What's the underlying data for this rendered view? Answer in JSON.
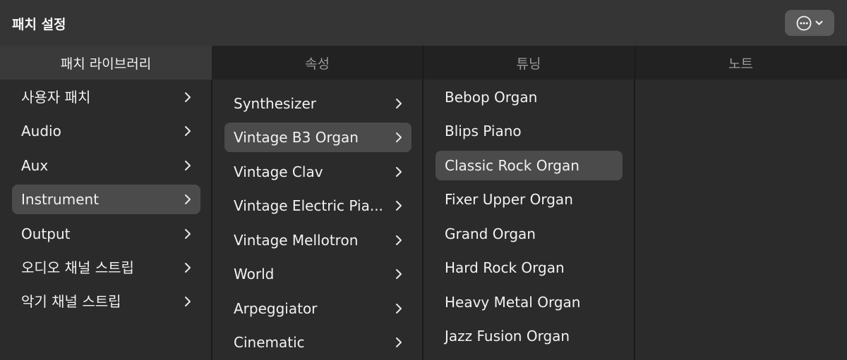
{
  "header": {
    "title": "패치 설정",
    "more_icon": "ellipsis-circle-icon",
    "menu_icon": "chevron-down-icon"
  },
  "tabs": [
    {
      "label": "패치 라이브러리",
      "active": true
    },
    {
      "label": "속성",
      "active": false
    },
    {
      "label": "튜닝",
      "active": false
    },
    {
      "label": "노트",
      "active": false
    }
  ],
  "library": {
    "items": [
      {
        "label": "사용자 패치"
      },
      {
        "label": "Audio"
      },
      {
        "label": "Aux"
      },
      {
        "label": "Instrument",
        "selected": true
      },
      {
        "label": "Output"
      },
      {
        "label": "오디오 채널 스트립"
      },
      {
        "label": "악기 채널 스트립"
      }
    ]
  },
  "categories": {
    "items": [
      {
        "label": "Synthesizer"
      },
      {
        "label": "Vintage B3 Organ",
        "selected": true
      },
      {
        "label": "Vintage Clav"
      },
      {
        "label": "Vintage Electric Pia..."
      },
      {
        "label": "Vintage Mellotron"
      },
      {
        "label": "World"
      },
      {
        "label": "Arpeggiator"
      },
      {
        "label": "Cinematic"
      }
    ]
  },
  "patches": {
    "items": [
      {
        "label": "Bebop Organ"
      },
      {
        "label": "Blips Piano"
      },
      {
        "label": "Classic Rock Organ",
        "selected": true
      },
      {
        "label": "Fixer Upper Organ"
      },
      {
        "label": "Grand Organ"
      },
      {
        "label": "Hard Rock Organ"
      },
      {
        "label": "Heavy Metal Organ"
      },
      {
        "label": "Jazz Fusion Organ"
      }
    ]
  },
  "colors": {
    "background": "#2b2b2b",
    "titlebar": "#353535",
    "tabbar": "#222222",
    "active_tab": "#3a3a3a",
    "selection": "#4b4b4b",
    "text": "#f2f2f2",
    "muted_text": "#9a9a9a"
  }
}
